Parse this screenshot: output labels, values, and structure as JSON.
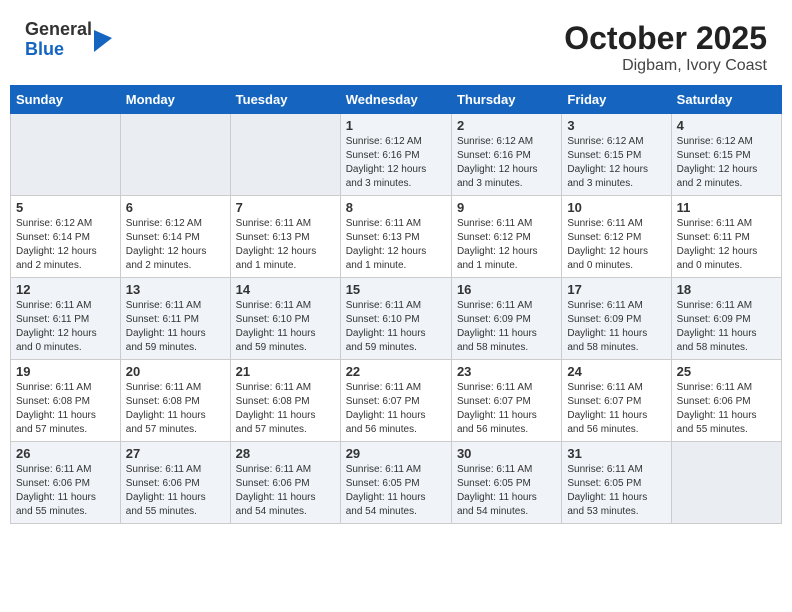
{
  "header": {
    "logo": {
      "general": "General",
      "blue": "Blue"
    },
    "title": "October 2025",
    "location": "Digbam, Ivory Coast"
  },
  "weekdays": [
    "Sunday",
    "Monday",
    "Tuesday",
    "Wednesday",
    "Thursday",
    "Friday",
    "Saturday"
  ],
  "weeks": [
    [
      {
        "day": "",
        "info": ""
      },
      {
        "day": "",
        "info": ""
      },
      {
        "day": "",
        "info": ""
      },
      {
        "day": "1",
        "info": "Sunrise: 6:12 AM\nSunset: 6:16 PM\nDaylight: 12 hours\nand 3 minutes."
      },
      {
        "day": "2",
        "info": "Sunrise: 6:12 AM\nSunset: 6:16 PM\nDaylight: 12 hours\nand 3 minutes."
      },
      {
        "day": "3",
        "info": "Sunrise: 6:12 AM\nSunset: 6:15 PM\nDaylight: 12 hours\nand 3 minutes."
      },
      {
        "day": "4",
        "info": "Sunrise: 6:12 AM\nSunset: 6:15 PM\nDaylight: 12 hours\nand 2 minutes."
      }
    ],
    [
      {
        "day": "5",
        "info": "Sunrise: 6:12 AM\nSunset: 6:14 PM\nDaylight: 12 hours\nand 2 minutes."
      },
      {
        "day": "6",
        "info": "Sunrise: 6:12 AM\nSunset: 6:14 PM\nDaylight: 12 hours\nand 2 minutes."
      },
      {
        "day": "7",
        "info": "Sunrise: 6:11 AM\nSunset: 6:13 PM\nDaylight: 12 hours\nand 1 minute."
      },
      {
        "day": "8",
        "info": "Sunrise: 6:11 AM\nSunset: 6:13 PM\nDaylight: 12 hours\nand 1 minute."
      },
      {
        "day": "9",
        "info": "Sunrise: 6:11 AM\nSunset: 6:12 PM\nDaylight: 12 hours\nand 1 minute."
      },
      {
        "day": "10",
        "info": "Sunrise: 6:11 AM\nSunset: 6:12 PM\nDaylight: 12 hours\nand 0 minutes."
      },
      {
        "day": "11",
        "info": "Sunrise: 6:11 AM\nSunset: 6:11 PM\nDaylight: 12 hours\nand 0 minutes."
      }
    ],
    [
      {
        "day": "12",
        "info": "Sunrise: 6:11 AM\nSunset: 6:11 PM\nDaylight: 12 hours\nand 0 minutes."
      },
      {
        "day": "13",
        "info": "Sunrise: 6:11 AM\nSunset: 6:11 PM\nDaylight: 11 hours\nand 59 minutes."
      },
      {
        "day": "14",
        "info": "Sunrise: 6:11 AM\nSunset: 6:10 PM\nDaylight: 11 hours\nand 59 minutes."
      },
      {
        "day": "15",
        "info": "Sunrise: 6:11 AM\nSunset: 6:10 PM\nDaylight: 11 hours\nand 59 minutes."
      },
      {
        "day": "16",
        "info": "Sunrise: 6:11 AM\nSunset: 6:09 PM\nDaylight: 11 hours\nand 58 minutes."
      },
      {
        "day": "17",
        "info": "Sunrise: 6:11 AM\nSunset: 6:09 PM\nDaylight: 11 hours\nand 58 minutes."
      },
      {
        "day": "18",
        "info": "Sunrise: 6:11 AM\nSunset: 6:09 PM\nDaylight: 11 hours\nand 58 minutes."
      }
    ],
    [
      {
        "day": "19",
        "info": "Sunrise: 6:11 AM\nSunset: 6:08 PM\nDaylight: 11 hours\nand 57 minutes."
      },
      {
        "day": "20",
        "info": "Sunrise: 6:11 AM\nSunset: 6:08 PM\nDaylight: 11 hours\nand 57 minutes."
      },
      {
        "day": "21",
        "info": "Sunrise: 6:11 AM\nSunset: 6:08 PM\nDaylight: 11 hours\nand 57 minutes."
      },
      {
        "day": "22",
        "info": "Sunrise: 6:11 AM\nSunset: 6:07 PM\nDaylight: 11 hours\nand 56 minutes."
      },
      {
        "day": "23",
        "info": "Sunrise: 6:11 AM\nSunset: 6:07 PM\nDaylight: 11 hours\nand 56 minutes."
      },
      {
        "day": "24",
        "info": "Sunrise: 6:11 AM\nSunset: 6:07 PM\nDaylight: 11 hours\nand 56 minutes."
      },
      {
        "day": "25",
        "info": "Sunrise: 6:11 AM\nSunset: 6:06 PM\nDaylight: 11 hours\nand 55 minutes."
      }
    ],
    [
      {
        "day": "26",
        "info": "Sunrise: 6:11 AM\nSunset: 6:06 PM\nDaylight: 11 hours\nand 55 minutes."
      },
      {
        "day": "27",
        "info": "Sunrise: 6:11 AM\nSunset: 6:06 PM\nDaylight: 11 hours\nand 55 minutes."
      },
      {
        "day": "28",
        "info": "Sunrise: 6:11 AM\nSunset: 6:06 PM\nDaylight: 11 hours\nand 54 minutes."
      },
      {
        "day": "29",
        "info": "Sunrise: 6:11 AM\nSunset: 6:05 PM\nDaylight: 11 hours\nand 54 minutes."
      },
      {
        "day": "30",
        "info": "Sunrise: 6:11 AM\nSunset: 6:05 PM\nDaylight: 11 hours\nand 54 minutes."
      },
      {
        "day": "31",
        "info": "Sunrise: 6:11 AM\nSunset: 6:05 PM\nDaylight: 11 hours\nand 53 minutes."
      },
      {
        "day": "",
        "info": ""
      }
    ]
  ]
}
